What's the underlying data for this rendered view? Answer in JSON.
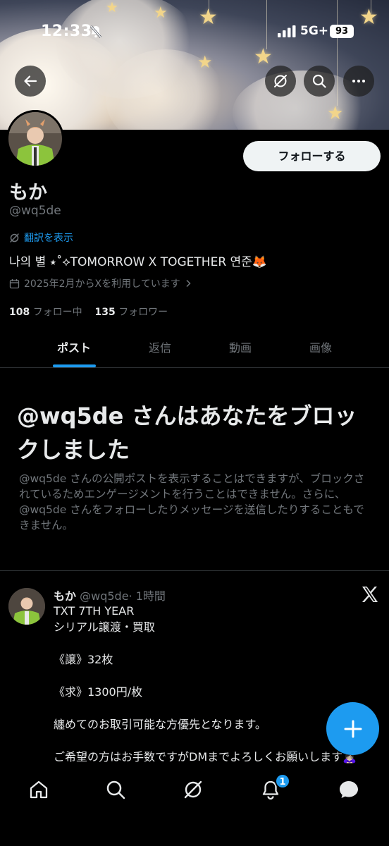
{
  "status_bar": {
    "time": "12:33",
    "network": "5G+",
    "battery": "93"
  },
  "profile": {
    "follow_button": "フォローする",
    "name": "もか",
    "handle": "@wq5de",
    "translate_label": "翻訳を表示",
    "bio": "나의 별 ⭑˚⟡TOMORROW X TOGETHER 연준🦊",
    "joined": "2025年2月からXを利用しています",
    "following_count": "108",
    "following_label": "フォロー中",
    "followers_count": "135",
    "followers_label": "フォロワー"
  },
  "tabs": [
    {
      "label": "ポスト",
      "active": true
    },
    {
      "label": "返信",
      "active": false
    },
    {
      "label": "動画",
      "active": false
    },
    {
      "label": "画像",
      "active": false
    }
  ],
  "blocked": {
    "title": "@wq5de さんはあなたをブロックしました",
    "description": "@wq5de さんの公開ポストを表示することはできますが、ブロックされているためエンゲージメントを行うことはできません。さらに、@wq5de さんをフォローしたりメッセージを送信したりすることもできません。"
  },
  "post": {
    "author_name": "もか",
    "author_handle": "@wq5de",
    "time": "· 1時間",
    "lines": [
      "TXT 7TH YEAR",
      "シリアル譲渡・買取",
      "",
      "《譲》32枚",
      "",
      "《求》1300円/枚",
      "",
      "纏めてのお取引可能な方優先となります。",
      "",
      "ご希望の方はお手数ですがDMまでよろしくお願いします🙇🏻‍♀️"
    ]
  },
  "nav": {
    "notifications_badge": "1"
  },
  "colors": {
    "accent": "#1d9bf0",
    "background": "#000000",
    "text_primary": "#e7e9ea",
    "text_secondary": "#71767b"
  }
}
